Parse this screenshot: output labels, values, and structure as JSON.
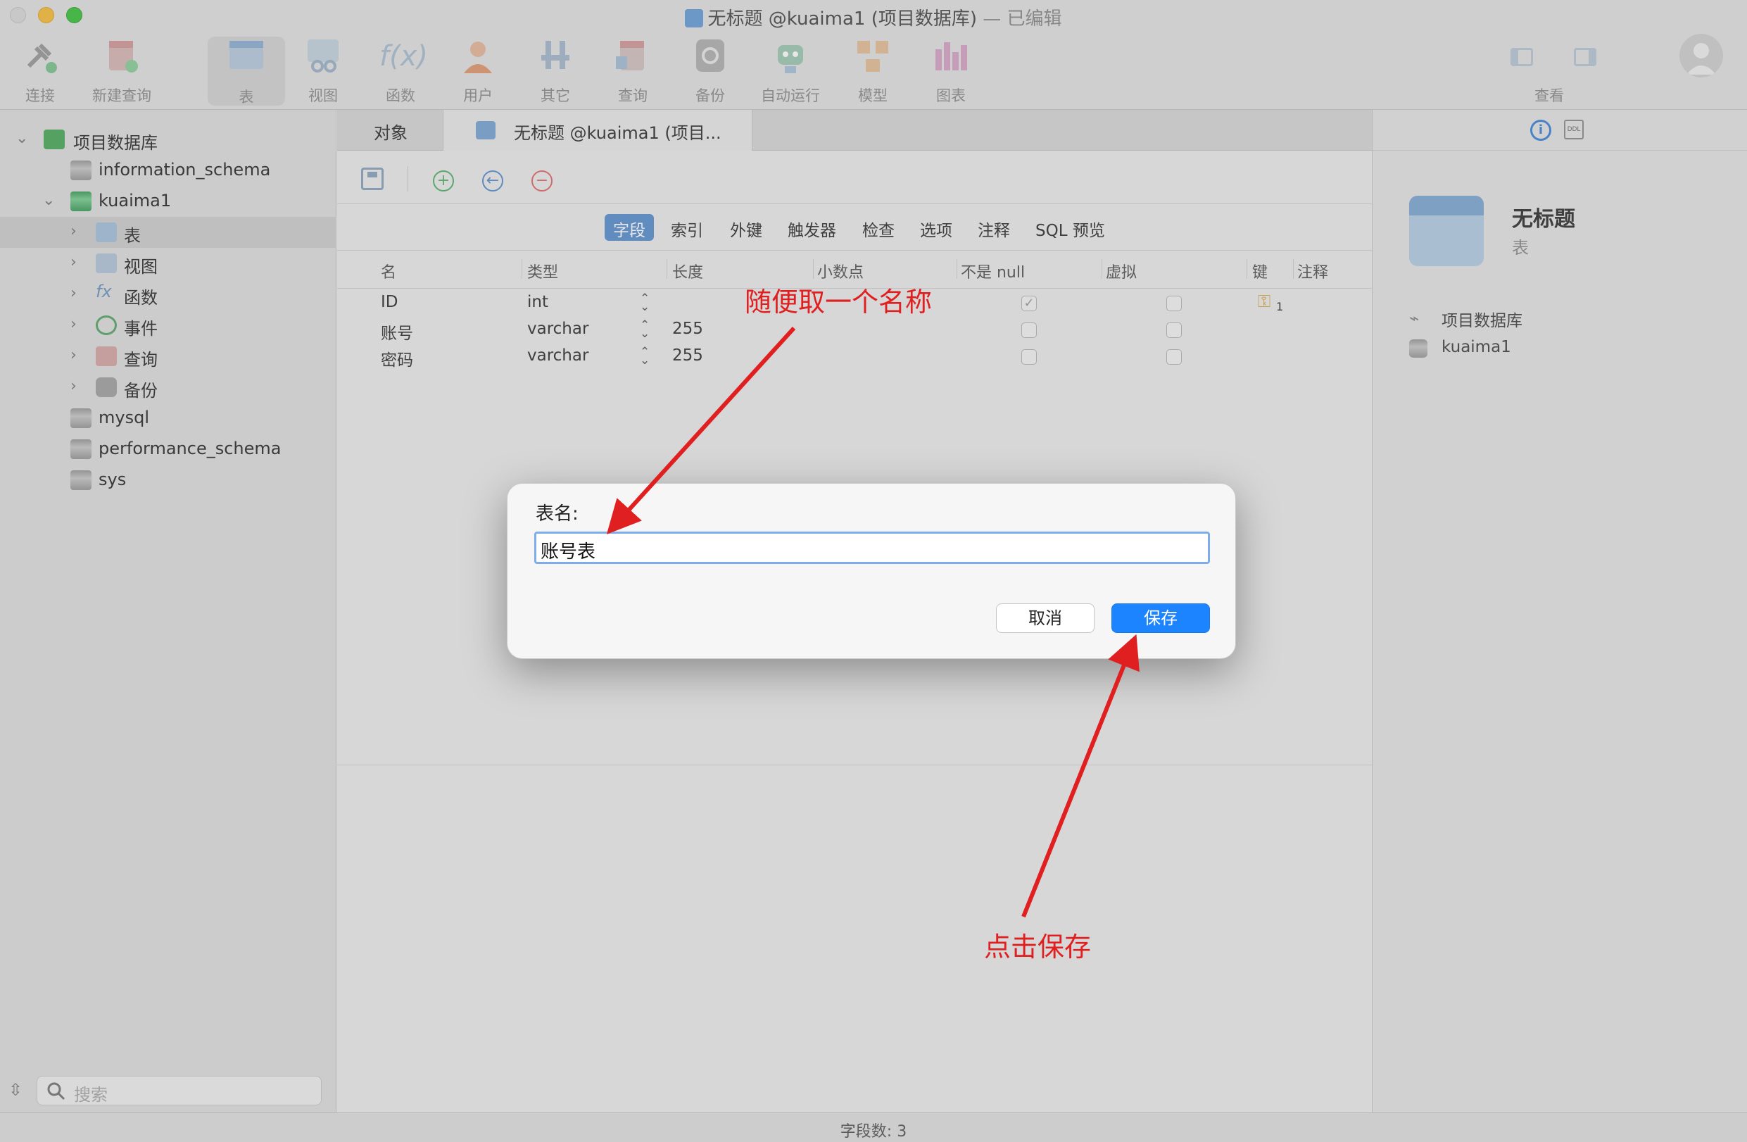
{
  "window": {
    "title_main": "无标题 @kuaima1 (项目数据库)",
    "title_suffix": " — 已编辑"
  },
  "toolbar": {
    "items": [
      {
        "label": "连接"
      },
      {
        "label": "新建查询"
      },
      {
        "label": "表"
      },
      {
        "label": "视图"
      },
      {
        "label": "函数"
      },
      {
        "label": "用户"
      },
      {
        "label": "其它"
      },
      {
        "label": "查询"
      },
      {
        "label": "备份"
      },
      {
        "label": "自动运行"
      },
      {
        "label": "模型"
      },
      {
        "label": "图表"
      }
    ],
    "view_label": "查看"
  },
  "sidebar": {
    "connection": "项目数据库",
    "items": [
      {
        "label": "information_schema"
      },
      {
        "label": "kuaima1"
      },
      {
        "label": "表"
      },
      {
        "label": "视图"
      },
      {
        "label": "函数"
      },
      {
        "label": "事件"
      },
      {
        "label": "查询"
      },
      {
        "label": "备份"
      },
      {
        "label": "mysql"
      },
      {
        "label": "performance_schema"
      },
      {
        "label": "sys"
      }
    ],
    "search_placeholder": "搜索"
  },
  "tabs": {
    "objects": "对象",
    "active": "无标题 @kuaima1 (项目..."
  },
  "subtabs": [
    "字段",
    "索引",
    "外键",
    "触发器",
    "检查",
    "选项",
    "注释",
    "SQL 预览"
  ],
  "grid": {
    "headers": [
      "名",
      "类型",
      "长度",
      "小数点",
      "不是 null",
      "虚拟",
      "键",
      "注释"
    ],
    "rows": [
      {
        "name": "ID",
        "type": "int",
        "length": "",
        "not_null": true,
        "key": "1"
      },
      {
        "name": "账号",
        "type": "varchar",
        "length": "255",
        "not_null": false,
        "key": ""
      },
      {
        "name": "密码",
        "type": "varchar",
        "length": "255",
        "not_null": false,
        "key": ""
      }
    ]
  },
  "right_panel": {
    "title": "无标题",
    "subtitle": "表",
    "connection": "项目数据库",
    "database": "kuaima1",
    "ddl_label": "DDL"
  },
  "status": {
    "field_count": "字段数: 3"
  },
  "dialog": {
    "label": "表名:",
    "value": "账号表",
    "cancel": "取消",
    "save": "保存"
  },
  "annotations": {
    "name_hint": "随便取一个名称",
    "save_hint": "点击保存",
    "color": "#e02020"
  }
}
